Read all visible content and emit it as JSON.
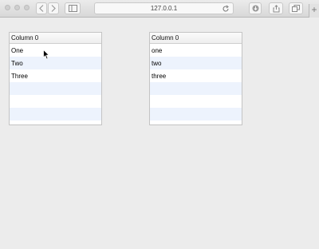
{
  "browser": {
    "address": "127.0.0.1"
  },
  "tables": [
    {
      "header": "Column 0",
      "rows": [
        "One",
        "Two",
        "Three",
        "",
        "",
        "",
        ""
      ]
    },
    {
      "header": "Column 0",
      "rows": [
        "one",
        "two",
        "three",
        "",
        "",
        "",
        ""
      ]
    }
  ],
  "colors": {
    "window_bg": "#ececec",
    "row_alt": "#edf3fd",
    "table_border": "#c4c4c4"
  }
}
